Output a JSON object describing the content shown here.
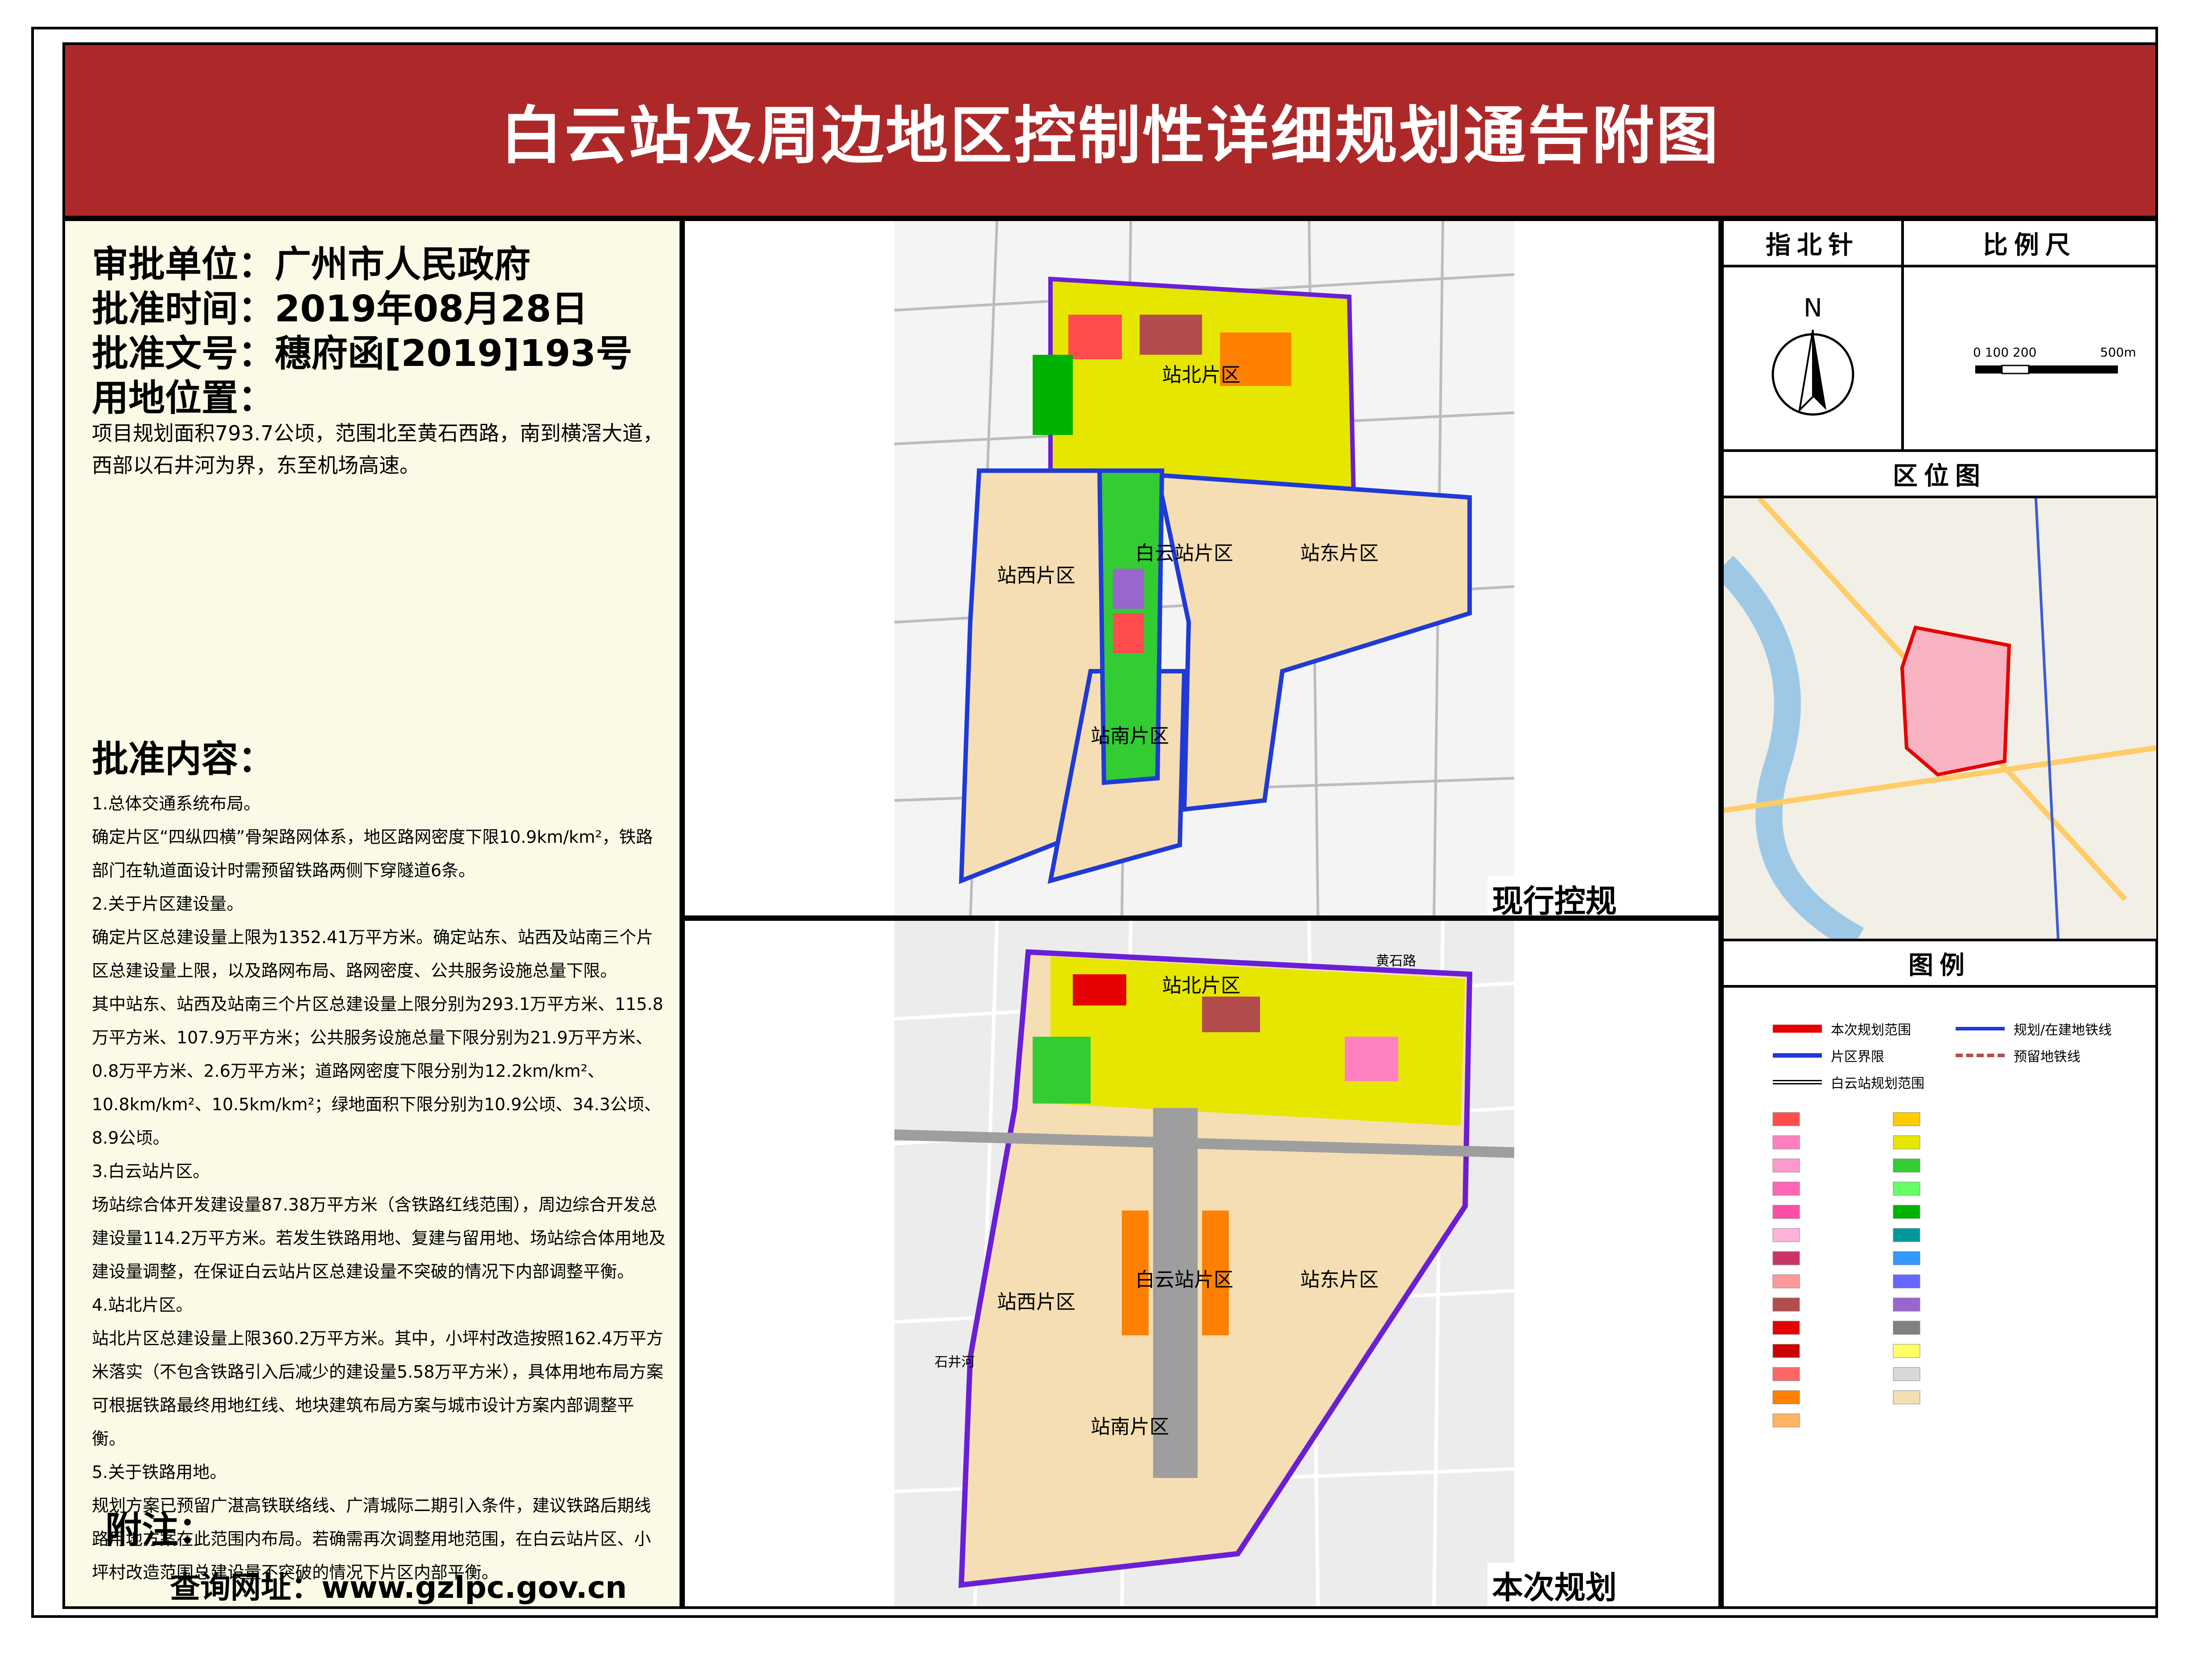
{
  "title": "白云站及周边地区控制性详细规划通告附图",
  "meta": {
    "approver_label": "审批单位：",
    "approver": "广州市人民政府",
    "date_label": "批准时间：",
    "date": "2019年08月28日",
    "doc_label": "批准文号：",
    "doc_no": "穗府函[2019]193号",
    "location_label": "用地位置：",
    "location_text": "项目规划面积793.7公顷，范围北至黄石西路，南到横滘大道，西部以石井河为界，东至机场高速。"
  },
  "approval": {
    "heading": "批准内容：",
    "paragraphs": [
      "1.总体交通系统布局。",
      "确定片区“四纵四横”骨架路网体系，地区路网密度下限10.9km/km²，铁路部门在轨道面设计时需预留铁路两侧下穿隧道6条。",
      "2.关于片区建设量。",
      "确定片区总建设量上限为1352.41万平方米。确定站东、站西及站南三个片区总建设量上限，以及路网布局、路网密度、公共服务设施总量下限。",
      "其中站东、站西及站南三个片区总建设量上限分别为293.1万平方米、115.8万平方米、107.9万平方米；公共服务设施总量下限分别为21.9万平方米、0.8万平方米、2.6万平方米；道路网密度下限分别为12.2km/km²、10.8km/km²、10.5km/km²；绿地面积下限分别为10.9公顷、34.3公顷、8.9公顷。",
      "3.白云站片区。",
      "场站综合体开发建设量87.38万平方米（含铁路红线范围），周边综合开发总建设量114.2万平方米。若发生铁路用地、复建与留用地、场站综合体用地及建设量调整，在保证白云站片区总建设量不突破的情况下内部调整平衡。",
      "4.站北片区。",
      "站北片区总建设量上限360.2万平方米。其中，小坪村改造按照162.4万平方米落实（不包含铁路引入后减少的建设量5.58万平方米），具体用地布局方案可根据铁路最终用地红线、地块建筑布局方案与城市设计方案内部调整平衡。",
      "5.关于铁路用地。",
      "规划方案已预留广湛高铁联络线、广清城际二期引入条件，建议铁路后期线路用地方案在此范围内布局。若确需再次调整用地范围，在白云站片区、小坪村改造范围总建设量不突破的情况下片区内部平衡。"
    ]
  },
  "footer": {
    "attach_label": "附注：",
    "query_label": "查询网址：",
    "url": "www.gzlpc.gov.cn"
  },
  "maps": {
    "current_label": "现行控规",
    "plan_label": "本次规划",
    "districts": {
      "north": "站北片区",
      "center": "白云站片区",
      "east": "站东片区",
      "west": "站西片区",
      "south": "站南片区"
    },
    "road_labels": {
      "huangshi": "黄石路",
      "shijing": "石井河"
    }
  },
  "right": {
    "compass_head": "指北针",
    "scale_head": "比例尺",
    "compass_n": "N",
    "scale_ticks": "0 100 200",
    "scale_end": "500m",
    "location_head": "区位图",
    "legend_head": "图例",
    "legend": {
      "plan_range": "本次规划范围",
      "district_boundary": "片区界限",
      "station_range": "白云站规划范围",
      "metro_planned": "规划/在建地铁线",
      "metro_reserved": "预留地铁线"
    },
    "land_use_colors": [
      "#ff4d4d",
      "#ff80c0",
      "#ff99cc",
      "#ff66b3",
      "#ff4da6",
      "#ffb3d9",
      "#cc3366",
      "#ff9999",
      "#b34d4d",
      "#e60000",
      "#cc0000",
      "#ff6666",
      "#ff8000",
      "#ffb366",
      "#ffcc00",
      "#e6e600",
      "#33cc33",
      "#66ff66",
      "#00b300",
      "#009999",
      "#3399ff",
      "#6666ff",
      "#9966cc",
      "#808080",
      "#ffff66",
      "#d9d9d9",
      "#f5deb3"
    ]
  },
  "colors": {
    "title_bg": "#ad2929",
    "panel_bg": "#fafae6",
    "boundary": "#6a1fd6",
    "district_line": "#1f3ad6",
    "zone_fill": "#f5deb3",
    "railway": "#9e9e9e"
  }
}
